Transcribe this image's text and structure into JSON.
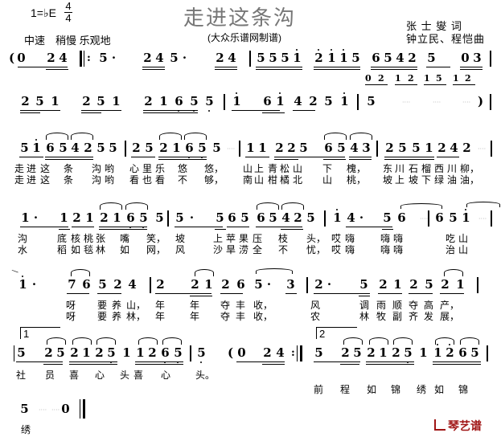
{
  "header": {
    "key": "1=♭E",
    "time_sig_top": "4",
    "time_sig_bottom": "4",
    "tempo": "中速　稍慢 乐观地",
    "title": "走进这条沟",
    "subtitle": "(大众乐谱网制谱)",
    "lyricist": "张 士 燮 词",
    "composer": "钟立民、程恺曲"
  },
  "rows": [
    {
      "notation": "(0 24 ||: 5. 245. 24 | 5551 2115 6542 5 03 |",
      "alt_line": "0 2 1 2 1 5 1 2"
    },
    {
      "notation": "251 251 21655 | i 6i 4251 | 5 - - - ) |"
    },
    {
      "notation": "5i654255 | 2521655 - | 11225 6543 | 2551242 - |",
      "lyrics1": "走进这 条 沟哟 心里乐 悠 悠， 山上青松山 下 槐， 东川石榴西川柳，",
      "lyrics2": "走进这 条 沟哟 看也看 不 够， 南山柑橘北 山 桃， 坡上坡下绿油油，"
    },
    {
      "notation": "1. 12121655 | 5. 56565425 | i4. 56 - | 65i - |",
      "lyrics1": "沟 底核桃张 嘴 笑， 坡 上苹果压 枝 头， 哎嗨 嗨嗨 吃山",
      "lyrics2": "水 稻如毯林 如 网， 风 沙旱涝全 不 忧， 哎嗨 嗨嗨 治山"
    },
    {
      "notation": "i. 76524 | 2 21265. 3 | 2. 5212521 |",
      "lyrics1": "呀 要养山， 年 年 夺丰收， 风 调雨顺夺高产，",
      "lyrics2": "呀 要养林， 年 年 夺丰收， 农 林牧副齐发展，"
    },
    {
      "notation": "[1] 5 2521251 11265 | 5 (0 24 :|| [2] 5 2521251 11265 |",
      "lyrics1": "社 员 喜 心 头喜 心 头。",
      "lyrics2": "前 程 如 锦 绣如 锦"
    },
    {
      "notation": "5 - 0 ||",
      "lyrics1": "绣"
    }
  ],
  "r1": {
    "paren": "(",
    "m0": [
      "0",
      "2",
      "4"
    ],
    "m1": [
      "5",
      "·",
      "2",
      "4",
      "5",
      "·",
      "2",
      "4"
    ],
    "m2": [
      "5",
      "5",
      "5",
      "1",
      "2",
      "1",
      "1",
      "5",
      "6",
      "5",
      "4",
      "2",
      "5",
      "0",
      "3"
    ],
    "alt": [
      "0",
      "2",
      "1",
      "2",
      "1",
      "5",
      "1",
      "2"
    ]
  },
  "r2": {
    "m1": [
      "2",
      "5",
      "1",
      "2",
      "5",
      "1",
      "2",
      "1",
      "6",
      "5",
      "5"
    ],
    "m2": [
      "1",
      "6",
      "1",
      "4",
      "2",
      "5",
      "1"
    ],
    "m3": [
      "5",
      ")"
    ]
  },
  "r3": {
    "m1": [
      "5",
      "1",
      "6",
      "5",
      "4",
      "2",
      "5",
      "5"
    ],
    "m2": [
      "2",
      "5",
      "2",
      "1",
      "6",
      "5",
      "5"
    ],
    "m3": [
      "1",
      "1",
      "2",
      "2",
      "5",
      "6",
      "5",
      "4",
      "3"
    ],
    "m4": [
      "2",
      "5",
      "5",
      "1",
      "2",
      "4",
      "2"
    ],
    "l1": [
      "走",
      "进",
      "这",
      "条",
      "沟",
      "哟",
      "心",
      "里",
      "乐",
      "悠",
      "悠，",
      "山",
      "上",
      "青",
      "松",
      "山",
      "下",
      "槐，",
      "东",
      "川",
      "石",
      "榴",
      "西",
      "川",
      "柳，"
    ],
    "l2": [
      "走",
      "进",
      "这",
      "条",
      "沟",
      "哟",
      "看",
      "也",
      "看",
      "不",
      "够，",
      "南",
      "山",
      "柑",
      "橘",
      "北",
      "山",
      "桃，",
      "坡",
      "上",
      "坡",
      "下",
      "绿",
      "油",
      "油，"
    ]
  },
  "r4": {
    "m1": [
      "1",
      "·",
      "1",
      "2",
      "1",
      "2",
      "1",
      "6",
      "5",
      "5"
    ],
    "m2": [
      "5",
      "·",
      "5",
      "6",
      "5",
      "6",
      "5",
      "4",
      "2",
      "5"
    ],
    "m3": [
      "1",
      "4",
      "·",
      "5",
      "6"
    ],
    "m4": [
      "6",
      "5",
      "1"
    ],
    "l1": [
      "沟",
      "底",
      "核",
      "桃",
      "张",
      "嘴",
      "笑，",
      "坡",
      "上",
      "苹",
      "果",
      "压",
      "枝",
      "头，",
      "哎",
      "嗨",
      "嗨",
      "嗨",
      "吃",
      "山"
    ],
    "l2": [
      "水",
      "稻",
      "如",
      "毯",
      "林",
      "如",
      "网，",
      "风",
      "沙",
      "旱",
      "涝",
      "全",
      "不",
      "忧，",
      "哎",
      "嗨",
      "嗨",
      "嗨",
      "治",
      "山"
    ]
  },
  "r5": {
    "m1": [
      "1",
      "·",
      "7",
      "6",
      "5",
      "2",
      "4"
    ],
    "m2": [
      "2",
      "2",
      "1",
      "2",
      "6",
      "5",
      "·",
      "3"
    ],
    "m3": [
      "2",
      "·",
      "5",
      "2",
      "1",
      "2",
      "5",
      "2",
      "1"
    ],
    "l1": [
      "呀",
      "要",
      "养",
      "山，",
      "年",
      "年",
      "夺",
      "丰",
      "收，",
      "风",
      "调",
      "雨",
      "顺",
      "夺",
      "高",
      "产，"
    ],
    "l2": [
      "呀",
      "要",
      "养",
      "林，",
      "年",
      "年",
      "夺",
      "丰",
      "收，",
      "农",
      "林",
      "牧",
      "副",
      "齐",
      "发",
      "展，"
    ]
  },
  "r6": {
    "volta1": "1",
    "volta2": "2",
    "m1": [
      "5",
      "2",
      "5",
      "2",
      "1",
      "2",
      "5",
      "1",
      "1",
      "2",
      "6",
      "5"
    ],
    "m2": [
      "5",
      "(",
      "0",
      "2",
      "4"
    ],
    "m3": [
      "5",
      "2",
      "5",
      "2",
      "1",
      "2",
      "5",
      "1",
      "1",
      "2",
      "6",
      "5"
    ],
    "l1": [
      "社",
      "员",
      "喜",
      "心",
      "头",
      "喜",
      "心",
      "头。"
    ],
    "l2": [
      "前",
      "程",
      "如",
      "锦",
      "绣",
      "如",
      "锦"
    ]
  },
  "r7": {
    "m1": [
      "5",
      "0"
    ],
    "l1": [
      "绣"
    ]
  },
  "watermark": "琴艺谱",
  "colors": {
    "title": "#777777",
    "watermark": "#a01515"
  }
}
